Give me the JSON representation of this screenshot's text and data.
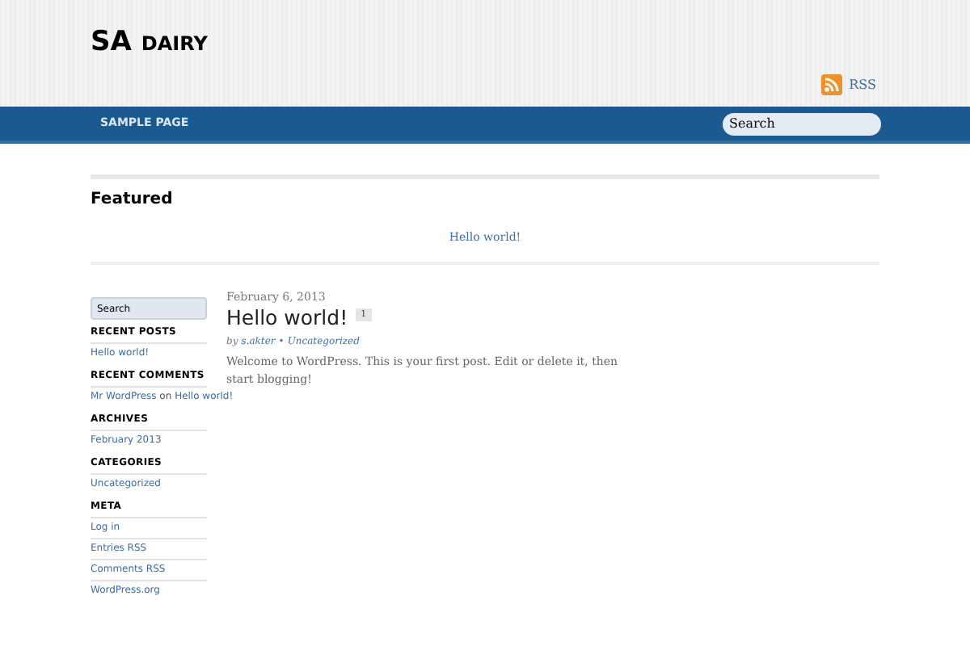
{
  "site": {
    "title": "SA",
    "title_small": "DAIRY"
  },
  "rss": {
    "label": "RSS"
  },
  "nav": {
    "items": [
      {
        "label": "SAMPLE PAGE"
      }
    ],
    "search": {
      "placeholder": "Search"
    }
  },
  "featured": {
    "heading": "Featured",
    "items": [
      "Hello world!"
    ]
  },
  "sidebar": {
    "search": {
      "placeholder": "Search"
    },
    "widgets": [
      {
        "title": "RECENT POSTS",
        "items": [
          [
            {
              "text": "Hello world!",
              "link": true
            }
          ]
        ]
      },
      {
        "title": "RECENT COMMENTS",
        "items": [
          [
            {
              "text": "Mr WordPress",
              "link": true
            },
            {
              "text": " on ",
              "link": false
            },
            {
              "text": "Hello world!",
              "link": true
            }
          ]
        ]
      },
      {
        "title": "ARCHIVES",
        "items": [
          [
            {
              "text": "February 2013",
              "link": true
            }
          ]
        ]
      },
      {
        "title": "CATEGORIES",
        "items": [
          [
            {
              "text": "Uncategorized",
              "link": true
            }
          ]
        ]
      },
      {
        "title": "META",
        "items": [
          [
            {
              "text": "Log in",
              "link": true
            }
          ],
          [
            {
              "text": "Entries RSS",
              "link": true
            }
          ],
          [
            {
              "text": "Comments RSS",
              "link": true
            }
          ],
          [
            {
              "text": "WordPress.org",
              "link": true
            }
          ]
        ]
      }
    ]
  },
  "posts": [
    {
      "date": "February 6, 2013",
      "title": "Hello world!",
      "comments": "1",
      "by": "by",
      "author": "s.akter",
      "separator": "•",
      "category": "Uncategorized",
      "excerpt": "Welcome to WordPress. This is your first post. Edit or delete it, then start blogging!"
    }
  ]
}
